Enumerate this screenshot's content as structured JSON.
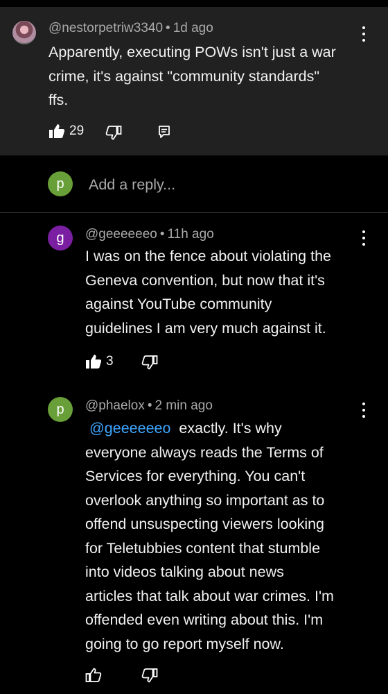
{
  "parent_comment": {
    "handle": "@nestorpetriw3340",
    "time": "1d ago",
    "text_lines": [
      "Apparently, executing POWs isn't just a war",
      "crime, it's against \"community standards\"",
      "ffs."
    ],
    "likes": "29"
  },
  "reply_box": {
    "avatar_letter": "p",
    "placeholder": "Add a reply..."
  },
  "replies": [
    {
      "avatar_letter": "g",
      "avatar_color": "#7b1fa2",
      "handle": "@geeeeeeo",
      "time": "11h ago",
      "text_lines": [
        "I was on the fence about violating the",
        "Geneva convention, but now that it's",
        "against YouTube community",
        "guidelines I am very much against it."
      ],
      "likes": "3"
    },
    {
      "avatar_letter": "p",
      "avatar_color": "#689f38",
      "handle": "@phaelox",
      "time": "2 min ago",
      "mention": "@geeeeeeo",
      "text_first_line_rest": "exactly. It's why",
      "text_lines": [
        "everyone always reads the Terms of",
        "Services for everything. You can't",
        "overlook anything so important as to",
        "offend unsuspecting viewers looking",
        "for Teletubbies content that stumble",
        "into videos talking about news",
        "articles that talk about war crimes. I'm",
        "offended even writing about this. I'm",
        "going to go report myself now."
      ]
    }
  ],
  "colors": {
    "background": "#000000",
    "parent_background": "#212121",
    "secondary_text": "#aaaaaa",
    "link": "#3ea6ff",
    "reply_avatar": "#689f38"
  },
  "dot_separator": "•"
}
